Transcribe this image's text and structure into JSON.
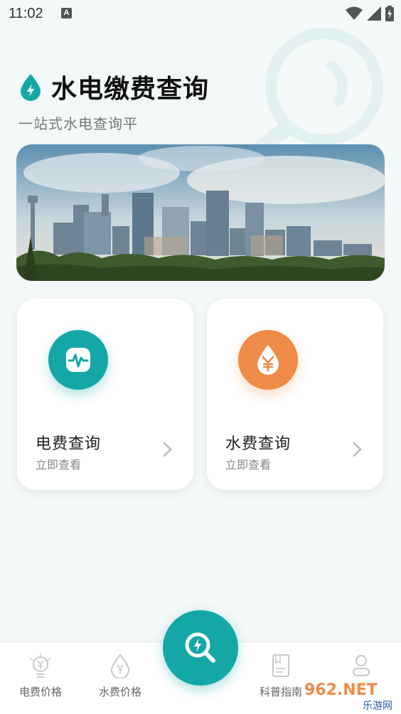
{
  "status_bar": {
    "time": "11:02",
    "badge": "A"
  },
  "header": {
    "title": "水电缴费查询",
    "subtitle": "一站式水电查询平"
  },
  "cards": [
    {
      "title": "电费查询",
      "subtitle": "立即查看",
      "icon": "pulse-icon",
      "color": "#14a7a6"
    },
    {
      "title": "水费查询",
      "subtitle": "立即查看",
      "icon": "yuan-drop-icon",
      "color": "#f08a47"
    }
  ],
  "nav": {
    "items": [
      {
        "label": "电费价格",
        "icon": "bulb-yuan-icon"
      },
      {
        "label": "水费价格",
        "icon": "drop-yuan-icon"
      },
      {
        "label": "科普指南",
        "icon": "book-icon"
      },
      {
        "label": "",
        "icon": "user-icon"
      }
    ],
    "fab_icon": "search-bolt-icon"
  },
  "watermark": {
    "top": "962.NET",
    "bottom": "乐游网"
  },
  "colors": {
    "accent": "#14a7a6",
    "orange": "#f08a47"
  }
}
